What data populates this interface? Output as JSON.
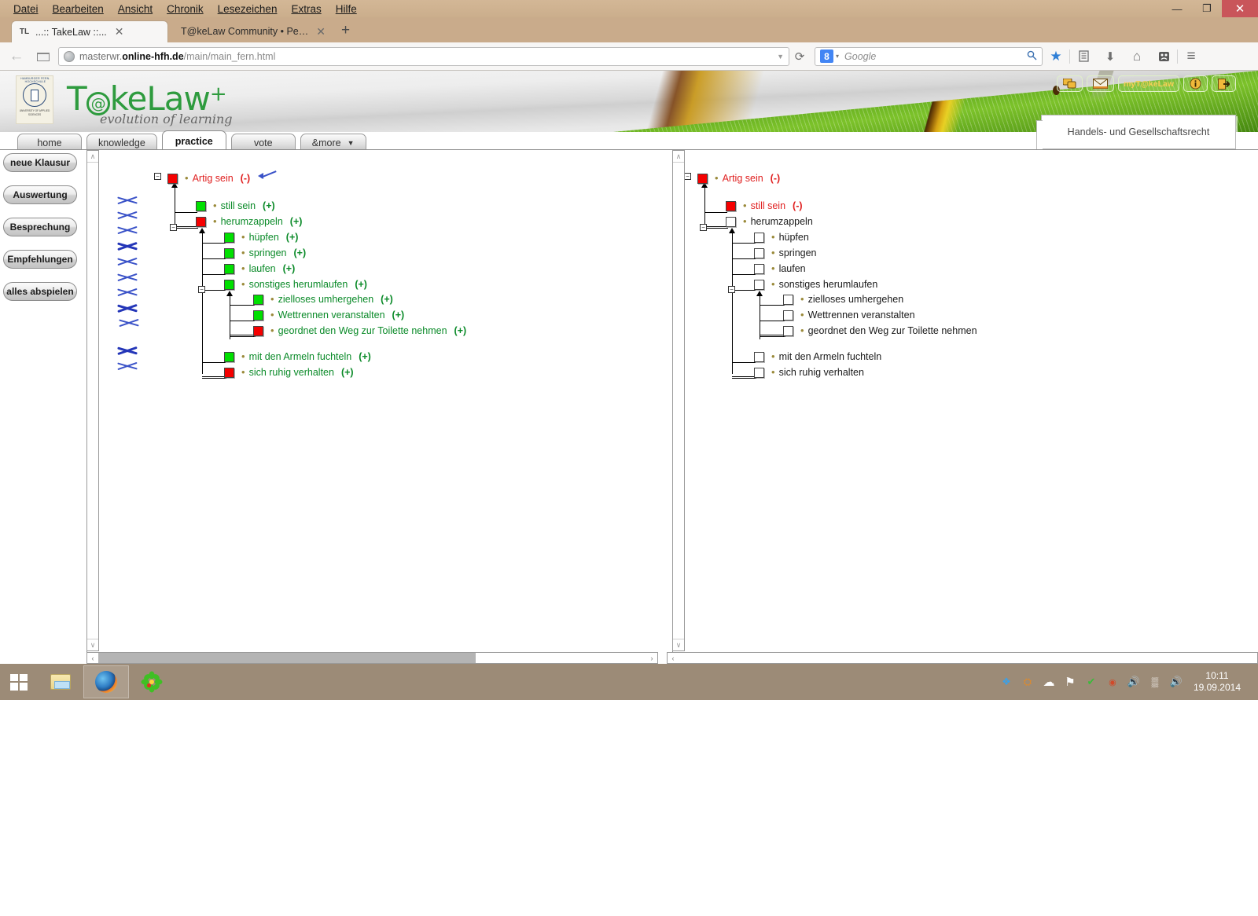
{
  "browser": {
    "menu": [
      {
        "label": "Datei",
        "accel": "D"
      },
      {
        "label": "Bearbeiten",
        "accel": "B"
      },
      {
        "label": "Ansicht",
        "accel": "A"
      },
      {
        "label": "Chronik",
        "accel": "C"
      },
      {
        "label": "Lesezeichen",
        "accel": "L"
      },
      {
        "label": "Extras",
        "accel": "x"
      },
      {
        "label": "Hilfe",
        "accel": "H"
      }
    ],
    "window_controls": {
      "minimize": "—",
      "restore": "❐",
      "close": "✕"
    },
    "tabs": [
      {
        "favicon": "TL",
        "title": "...:: TakeLaw ::...",
        "close": "✕",
        "active": true
      },
      {
        "favicon": "",
        "title": "T@keLaw Community • Persön...",
        "close": "✕",
        "active": false
      }
    ],
    "new_tab_label": "+",
    "back_icon": "←",
    "reload_icon": "⟳",
    "url": {
      "prefix": "masterwr.",
      "host": "online-hfh.de",
      "path": "/main/main_fern.html",
      "dropdown_caret": "▼"
    },
    "search": {
      "engine_badge": "8",
      "engine_caret": "▾",
      "placeholder": "Google",
      "magnifier": "🔍"
    },
    "toolbar_icons": [
      {
        "name": "bookmark-star-icon",
        "glyph": "★",
        "color": "#2f7fd6"
      },
      {
        "name": "library-icon",
        "glyph": "☰",
        "color": "#6f6f6f"
      },
      {
        "name": "downloads-icon",
        "glyph": "⬇",
        "color": "#6f6f6f"
      },
      {
        "name": "home-icon",
        "glyph": "⌂",
        "color": "#6f6f6f"
      },
      {
        "name": "sad-face-icon",
        "glyph": "☹",
        "color": "#5a5a5a"
      },
      {
        "name": "hamburger-menu-icon",
        "glyph": "≡",
        "color": "#6f6f6f"
      }
    ]
  },
  "site": {
    "logo": {
      "text_before": "T",
      "at": "@",
      "text_after": "keLaw",
      "plus": "+",
      "tagline": "evolution of learning"
    },
    "crest": {
      "top_text": "HAMBURGER FERN-HOCHSCHULE",
      "bottom_text": "UNIVERSITY OF APPLIED SCIENCES"
    },
    "top_icons": [
      {
        "name": "chat-icon",
        "label": "💬"
      },
      {
        "name": "mail-icon",
        "label": "✉"
      },
      {
        "name": "my-takelaw-button",
        "label": "myT@keLaw"
      },
      {
        "name": "info-icon",
        "label": "i"
      },
      {
        "name": "logout-icon",
        "label": "⇥"
      }
    ],
    "nav_tabs": [
      {
        "label": "home",
        "active": false
      },
      {
        "label": "knowledge",
        "active": false
      },
      {
        "label": "practice",
        "active": true
      },
      {
        "label": "vote",
        "active": false
      },
      {
        "label": "&more",
        "active": false,
        "caret": "▼"
      }
    ],
    "course_title": "Handels- und Gesellschaftsrecht",
    "rail_buttons": [
      {
        "label": "neue Klausur"
      },
      {
        "label": "Auswertung"
      },
      {
        "label": "Besprechung"
      },
      {
        "label": "Empfehlungen"
      },
      {
        "label": "alles abspielen"
      }
    ]
  },
  "left_pane": {
    "tree": [
      {
        "label": "Artig sein",
        "sign": "(-)",
        "color": "red",
        "box": "red",
        "indent": 0
      },
      {
        "label": "still sein",
        "sign": "(+)",
        "color": "green",
        "box": "green",
        "indent": 1
      },
      {
        "label": "herumzappeln",
        "sign": "(+)",
        "color": "green",
        "box": "red",
        "indent": 1
      },
      {
        "label": "hüpfen",
        "sign": "(+)",
        "color": "green",
        "box": "green",
        "indent": 2
      },
      {
        "label": "springen",
        "sign": "(+)",
        "color": "green",
        "box": "green",
        "indent": 2
      },
      {
        "label": "laufen",
        "sign": "(+)",
        "color": "green",
        "box": "green",
        "indent": 2
      },
      {
        "label": "sonstiges herumlaufen",
        "sign": "(+)",
        "color": "green",
        "box": "green",
        "indent": 2
      },
      {
        "label": "zielloses umhergehen",
        "sign": "(+)",
        "color": "green",
        "box": "green",
        "indent": 3
      },
      {
        "label": "Wettrennen veranstalten",
        "sign": "(+)",
        "color": "green",
        "box": "green",
        "indent": 3
      },
      {
        "label": "geordnet den Weg zur Toilette nehmen",
        "sign": "(+)",
        "color": "green",
        "box": "red",
        "indent": 3
      },
      {
        "label": "mit den Armeln fuchteln",
        "sign": "(+)",
        "color": "green",
        "box": "green",
        "indent": 2
      },
      {
        "label": "sich ruhig verhalten",
        "sign": "(+)",
        "color": "green",
        "box": "red",
        "indent": 2
      }
    ],
    "xmark_count": 11
  },
  "right_pane": {
    "tree": [
      {
        "label": "Artig sein",
        "sign": "(-)",
        "color": "red",
        "box": "red",
        "indent": 0
      },
      {
        "label": "still sein",
        "sign": "(-)",
        "color": "red",
        "box": "red",
        "indent": 1
      },
      {
        "label": "herumzappeln",
        "sign": "",
        "color": "black",
        "box": "white",
        "indent": 1
      },
      {
        "label": "hüpfen",
        "sign": "",
        "color": "black",
        "box": "white",
        "indent": 2
      },
      {
        "label": "springen",
        "sign": "",
        "color": "black",
        "box": "white",
        "indent": 2
      },
      {
        "label": "laufen",
        "sign": "",
        "color": "black",
        "box": "white",
        "indent": 2
      },
      {
        "label": "sonstiges herumlaufen",
        "sign": "",
        "color": "black",
        "box": "white",
        "indent": 2
      },
      {
        "label": "zielloses umhergehen",
        "sign": "",
        "color": "black",
        "box": "white",
        "indent": 3
      },
      {
        "label": "Wettrennen veranstalten",
        "sign": "",
        "color": "black",
        "box": "white",
        "indent": 3
      },
      {
        "label": "geordnet den Weg zur Toilette nehmen",
        "sign": "",
        "color": "black",
        "box": "white",
        "indent": 3
      },
      {
        "label": "mit den Armeln fuchteln",
        "sign": "",
        "color": "black",
        "box": "white",
        "indent": 2
      },
      {
        "label": "sich ruhig verhalten",
        "sign": "",
        "color": "black",
        "box": "white",
        "indent": 2
      }
    ]
  },
  "scrollbars": {
    "up_arrow": "∧",
    "down_arrow": "∨",
    "left_arrow": "‹",
    "right_arrow": "›"
  },
  "taskbar": {
    "start_label": "Start",
    "apps": [
      {
        "name": "file-explorer-icon"
      },
      {
        "name": "firefox-icon",
        "active": true
      },
      {
        "name": "icq-icon"
      }
    ],
    "tray_icons": [
      {
        "name": "dropbox-icon",
        "glyph": "❖",
        "color": "#3aa0e8"
      },
      {
        "name": "user-shield-icon",
        "glyph": "⛭",
        "color": "#e08a2a"
      },
      {
        "name": "cloud-icon",
        "glyph": "☁",
        "color": "#ffffff"
      },
      {
        "name": "flag-icon",
        "glyph": "⚑",
        "color": "#ffffff"
      },
      {
        "name": "checkmark-icon",
        "glyph": "✔",
        "color": "#3abb3a"
      },
      {
        "name": "alert-icon",
        "glyph": "◉",
        "color": "#d04a2a"
      },
      {
        "name": "volume-speaker-icon",
        "glyph": "🔊",
        "color": "#e04a1a"
      },
      {
        "name": "network-icon",
        "glyph": "▒",
        "color": "#ffffff"
      },
      {
        "name": "volume-icon",
        "glyph": "🔊",
        "color": "#ffffff"
      }
    ],
    "time": "10:11",
    "date": "19.09.2014"
  },
  "colors": {
    "node_red": "#f50000",
    "node_green": "#00e000",
    "label_red": "#e02020",
    "label_green": "#0a8a28",
    "xmark_blue": "#3a52c8",
    "brand_green": "#2e9b3e"
  }
}
